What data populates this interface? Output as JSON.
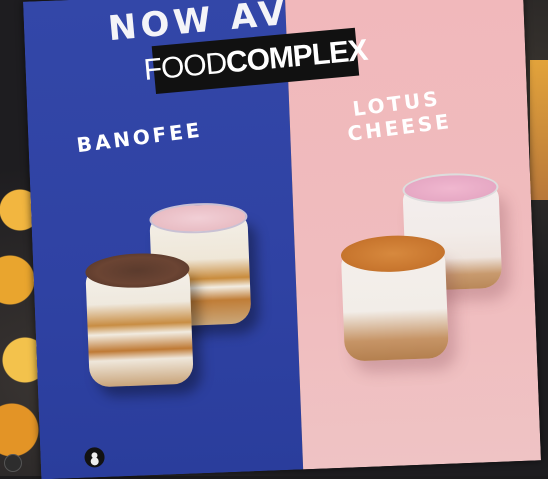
{
  "headline": "NOW AV",
  "logo": {
    "thin": "FOOD",
    "bold": "COMPLEX"
  },
  "flavors": [
    {
      "label": "BANOFEE"
    },
    {
      "label_line1": "LOTUS",
      "label_line2": "CHEESE"
    }
  ],
  "colors": {
    "left_panel": "#3347a8",
    "right_panel": "#f1b8bb"
  }
}
